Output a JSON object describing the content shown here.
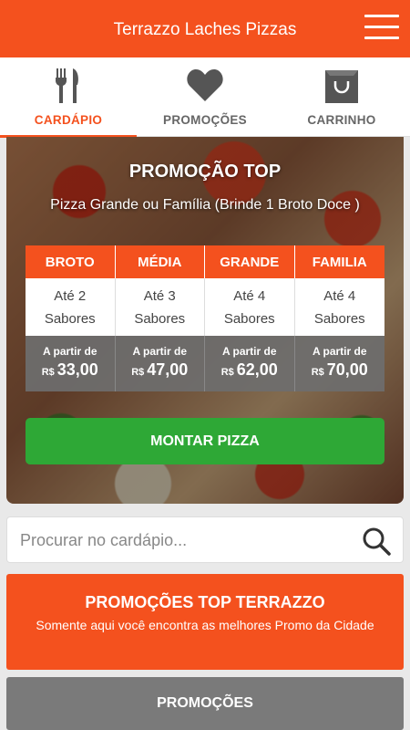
{
  "header": {
    "title": "Terrazzo Laches Pizzas"
  },
  "tabs": [
    {
      "label": "CARDÁPIO",
      "icon": "cutlery-icon"
    },
    {
      "label": "PROMOÇÕES",
      "icon": "heart-icon"
    },
    {
      "label": "CARRINHO",
      "icon": "shopping-bag-icon"
    }
  ],
  "hero": {
    "title": "PROMOÇÃO TOP",
    "subtitle": "Pizza Grande ou Família (Brinde 1 Broto Doce )",
    "sizes": [
      {
        "name": "BROTO",
        "flavors_line1": "Até 2",
        "flavors_line2": "Sabores",
        "from": "A partir de",
        "currency": "R$",
        "price": "33,00"
      },
      {
        "name": "MÉDIA",
        "flavors_line1": "Até 3",
        "flavors_line2": "Sabores",
        "from": "A partir de",
        "currency": "R$",
        "price": "47,00"
      },
      {
        "name": "GRANDE",
        "flavors_line1": "Até 4",
        "flavors_line2": "Sabores",
        "from": "A partir de",
        "currency": "R$",
        "price": "62,00"
      },
      {
        "name": "FAMILIA",
        "flavors_line1": "Até 4",
        "flavors_line2": "Sabores",
        "from": "A partir de",
        "currency": "R$",
        "price": "70,00"
      }
    ],
    "button": "MONTAR PIZZA"
  },
  "search": {
    "placeholder": "Procurar no cardápio..."
  },
  "promo_banner": {
    "title": "PROMOÇÕES TOP TERRAZZO",
    "description": "Somente aqui você encontra as melhores Promo da Cidade"
  },
  "promo_button": "PROMOÇÕES",
  "colors": {
    "accent": "#f4511e",
    "green": "#2ea836",
    "gray": "#7a7a7a"
  }
}
